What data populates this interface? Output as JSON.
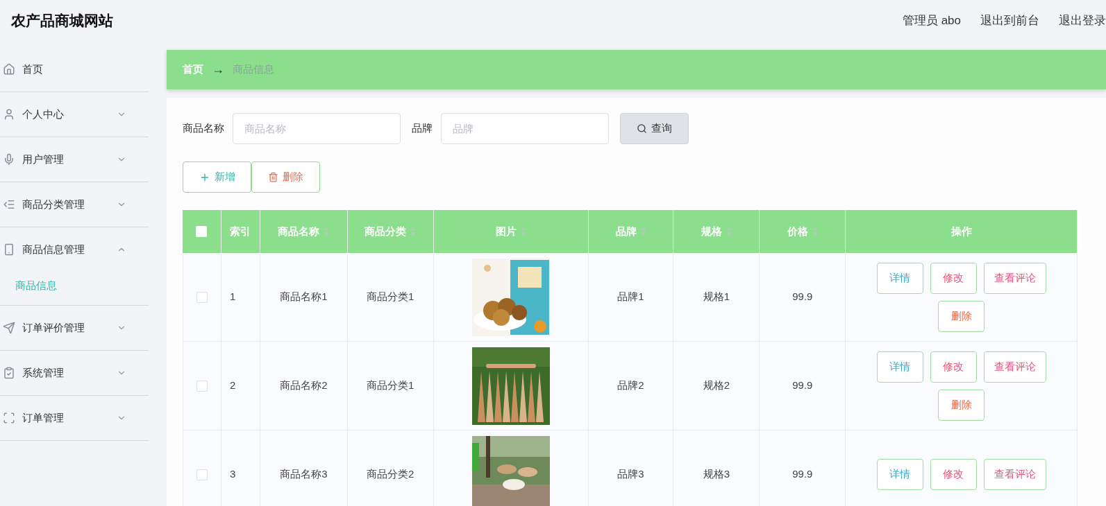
{
  "header": {
    "title": "农产品商城网站",
    "links": [
      "管理员 abo",
      "退出到前台",
      "退出登录"
    ]
  },
  "sidebar": {
    "items": [
      {
        "label": "首页",
        "kind": "link"
      },
      {
        "label": "个人中心",
        "kind": "menu",
        "expanded": false
      },
      {
        "label": "用户管理",
        "kind": "menu",
        "expanded": false
      },
      {
        "label": "商品分类管理",
        "kind": "menu",
        "expanded": false
      },
      {
        "label": "商品信息管理",
        "kind": "menu",
        "expanded": true,
        "children": [
          {
            "label": "商品信息",
            "selected": true
          }
        ]
      },
      {
        "label": "订单评价管理",
        "kind": "menu",
        "expanded": false
      },
      {
        "label": "系统管理",
        "kind": "menu",
        "expanded": false
      },
      {
        "label": "订单管理",
        "kind": "menu",
        "expanded": false
      }
    ]
  },
  "breadcrumb": {
    "items": [
      "首页",
      "商品信息"
    ],
    "separator": "→"
  },
  "search": {
    "fields": [
      {
        "label": "商品名称",
        "placeholder": "商品名称"
      },
      {
        "label": "品牌",
        "placeholder": "品牌"
      }
    ],
    "button": "查询"
  },
  "toolbar": [
    {
      "label": "新增",
      "kind": "add"
    },
    {
      "label": "删除",
      "kind": "delete"
    }
  ],
  "table": {
    "select_all_checked": false,
    "columns": [
      {
        "label": "索引",
        "sortable": false
      },
      {
        "label": "商品名称",
        "sortable": true
      },
      {
        "label": "商品分类",
        "sortable": true
      },
      {
        "label": "图片",
        "sortable": true
      },
      {
        "label": "品牌",
        "sortable": true
      },
      {
        "label": "规格",
        "sortable": true
      },
      {
        "label": "价格",
        "sortable": true
      },
      {
        "label": "操作",
        "sortable": false
      }
    ],
    "rows": [
      {
        "checked": false,
        "index": "1",
        "name": "商品名称1",
        "category": "商品分类1",
        "image": {
          "kind": "picture"
        },
        "brand": "品牌1",
        "spec": "规格1",
        "price": "99.9",
        "actions": [
          {
            "label": "详情",
            "kind": "info"
          },
          {
            "label": "修改",
            "kind": "edit"
          },
          {
            "label": "查看评论",
            "kind": "edit"
          },
          {
            "label": "删除",
            "kind": "delete"
          }
        ]
      },
      {
        "checked": false,
        "index": "2",
        "name": "商品名称2",
        "category": "商品分类1",
        "image": {
          "kind": "picture"
        },
        "brand": "品牌2",
        "spec": "规格2",
        "price": "99.9",
        "actions": [
          {
            "label": "详情",
            "kind": "info"
          },
          {
            "label": "修改",
            "kind": "edit"
          },
          {
            "label": "查看评论",
            "kind": "edit"
          },
          {
            "label": "删除",
            "kind": "delete"
          }
        ]
      },
      {
        "checked": false,
        "index": "3",
        "name": "商品名称3",
        "category": "商品分类2",
        "image": {
          "kind": "picture"
        },
        "brand": "品牌3",
        "spec": "规格3",
        "price": "99.9",
        "actions": [
          {
            "label": "详情",
            "kind": "info"
          },
          {
            "label": "修改",
            "kind": "edit"
          },
          {
            "label": "查看评论",
            "kind": "edit"
          }
        ]
      }
    ]
  }
}
